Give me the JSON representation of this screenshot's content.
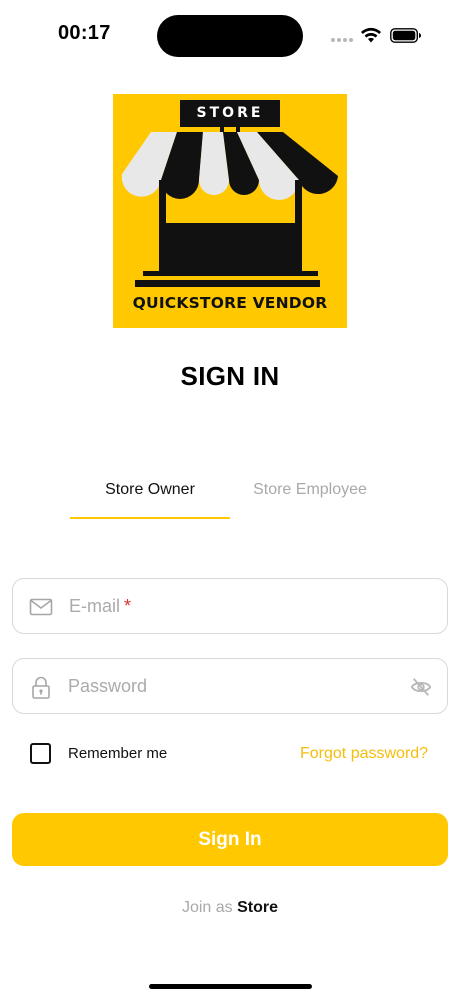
{
  "status_bar": {
    "time": "00:17"
  },
  "logo": {
    "sign_text": "STORE",
    "brand_text": "QUICKSTORE VENDOR"
  },
  "page": {
    "title": "SIGN IN"
  },
  "tabs": [
    {
      "label": "Store Owner",
      "active": true
    },
    {
      "label": "Store Employee",
      "active": false
    }
  ],
  "form": {
    "email": {
      "placeholder": "E-mail",
      "required_mark": "*",
      "value": "",
      "icon": "mail-icon"
    },
    "password": {
      "placeholder": "Password",
      "value": "",
      "icon": "lock-icon",
      "toggle_icon": "eye-off-icon"
    },
    "remember_label": "Remember me",
    "remember_checked": false,
    "forgot_label": "Forgot password?",
    "submit_label": "Sign In"
  },
  "footer": {
    "join_prefix": "Join as",
    "join_link": "Store"
  },
  "colors": {
    "accent": "#FFC800",
    "link": "#F5BE0B",
    "required": "#E03030",
    "muted": "#A9A9A9"
  }
}
